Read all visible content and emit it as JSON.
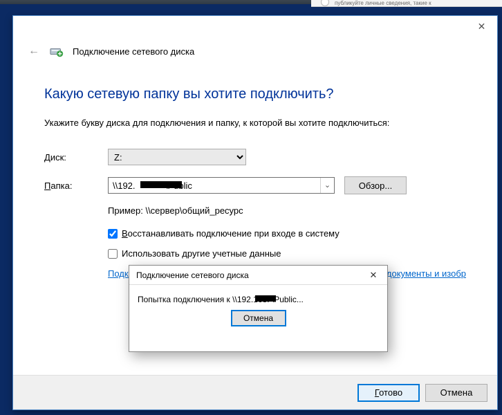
{
  "top_strip_hint": "публикуйте личные сведения, такие к",
  "wizard": {
    "title": "Подключение сетевого диска",
    "heading": "Какую сетевую папку вы хотите подключить?",
    "instruction": "Укажите букву диска для подключения и папку, к которой вы хотите подключиться:",
    "drive_label_pre": "Д",
    "drive_label_post": "иск:",
    "drive_value": "Z:",
    "folder_label_pre": "П",
    "folder_label_post": "апка:",
    "folder_value": "\\\\192.            \\Public",
    "browse_label": "Обзор...",
    "example": "Пример: \\\\сервер\\общий_ресурс",
    "reconnect": {
      "checked": true,
      "pre": "В",
      "post": "осстанавливать подключение при входе в систему"
    },
    "othercreds": {
      "checked": false,
      "pre": "Использовать другие учетные ",
      "u": "д",
      "post": "анные"
    },
    "link_left": "Подкл",
    "link_right": " документы и изобр",
    "finish_pre": "Г",
    "finish_post": "отово",
    "cancel": "Отмена"
  },
  "progress": {
    "title": "Подключение сетевого диска",
    "message": "Попытка подключения к \\\\192.168.       \\Public...",
    "cancel": "Отмена"
  }
}
